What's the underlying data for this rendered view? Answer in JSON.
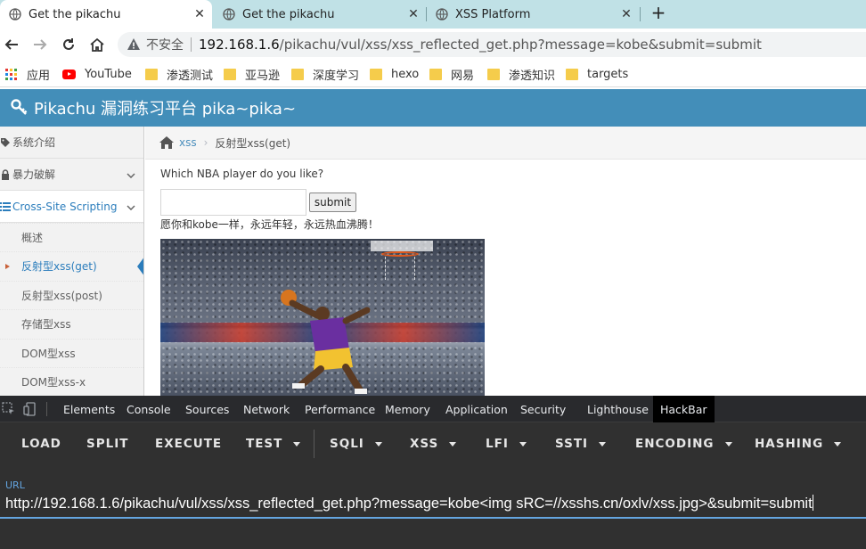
{
  "browser": {
    "tabs": [
      {
        "title": "Get the pikachu",
        "active": true
      },
      {
        "title": "Get the pikachu",
        "active": false
      },
      {
        "title": "XSS Platform",
        "active": false
      }
    ],
    "new_tab_icon": "plus-icon",
    "omnibox": {
      "security_label": "不安全",
      "host": "192.168.1.6",
      "path": "/pikachu/vul/xss/xss_reflected_get.php?message=kobe&submit=submit"
    },
    "bookmarks": [
      {
        "label": "应用",
        "icon": "apps-grid-icon"
      },
      {
        "label": "YouTube",
        "icon": "youtube-icon"
      },
      {
        "label": "渗透测试",
        "icon": "folder-icon"
      },
      {
        "label": "亚马逊",
        "icon": "folder-icon"
      },
      {
        "label": "深度学习",
        "icon": "folder-icon"
      },
      {
        "label": "hexo",
        "icon": "folder-icon"
      },
      {
        "label": "网易",
        "icon": "folder-icon"
      },
      {
        "label": "渗透知识",
        "icon": "folder-icon"
      },
      {
        "label": "targets",
        "icon": "folder-icon"
      }
    ]
  },
  "site": {
    "brand": "Pikachu 漏洞练习平台 pika~pika~",
    "header_color": "#438eb9",
    "accent_color": "#2b7dbc"
  },
  "sidebar": {
    "items": [
      {
        "label": "系统介绍",
        "icon": "tag-icon"
      },
      {
        "label": "暴力破解",
        "icon": "lock-icon"
      },
      {
        "label": "Cross-Site Scripting",
        "icon": "list-icon"
      }
    ],
    "submenu": [
      {
        "label": "概述",
        "active": false
      },
      {
        "label": "反射型xss(get)",
        "active": true
      },
      {
        "label": "反射型xss(post)",
        "active": false
      },
      {
        "label": "存储型xss",
        "active": false
      },
      {
        "label": "DOM型xss",
        "active": false
      },
      {
        "label": "DOM型xss-x",
        "active": false
      }
    ]
  },
  "main": {
    "breadcrumb": {
      "link": "xss",
      "current": "反射型xss(get)"
    },
    "question": "Which NBA player do you like?",
    "input_value": "",
    "submit_label": "submit",
    "result_text": "愿你和kobe一样，永远年轻，永远热血沸腾！"
  },
  "devtools": {
    "tabs": [
      "Elements",
      "Console",
      "Sources",
      "Network",
      "Performance",
      "Memory",
      "Application",
      "Security",
      "Lighthouse",
      "HackBar"
    ],
    "active_tab": "HackBar",
    "hackbar": {
      "buttons": [
        "LOAD",
        "SPLIT",
        "EXECUTE",
        "TEST",
        "SQLI",
        "XSS",
        "LFI",
        "SSTI",
        "ENCODING",
        "HASHING"
      ],
      "url_label": "URL",
      "url_value": "http://192.168.1.6/pikachu/vul/xss/xss_reflected_get.php?message=kobe<img sRC=//xsshs.cn/oxlv/xss.jpg>&submit=submit"
    }
  }
}
